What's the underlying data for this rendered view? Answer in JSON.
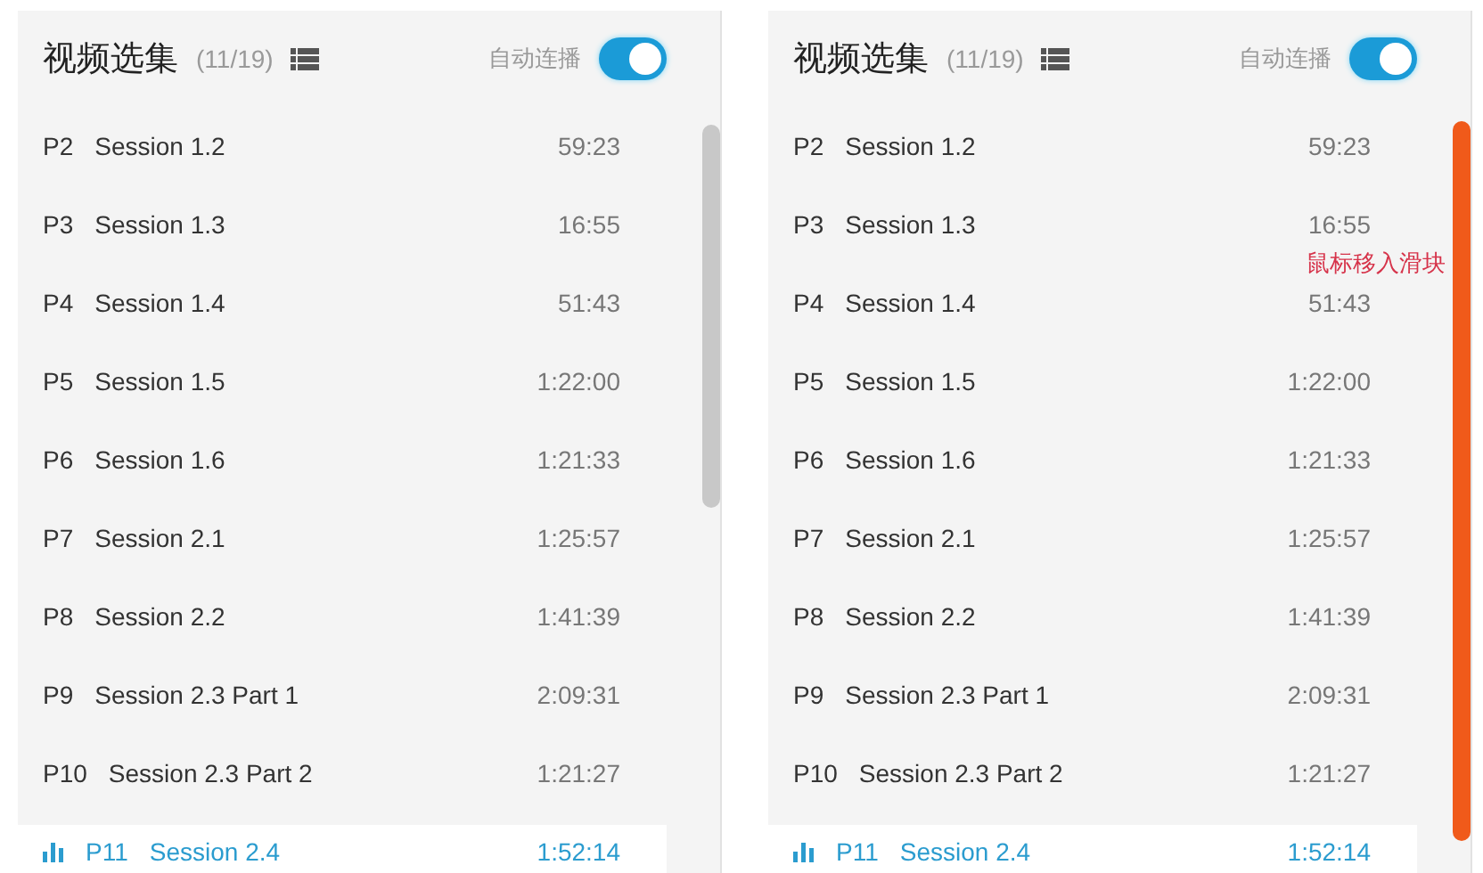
{
  "panels": [
    {
      "title": "视频选集",
      "count": "(11/19)",
      "autoplay": {
        "label": "自动连播",
        "on": true
      },
      "scrollbar": {
        "hovered": false
      },
      "items": [
        {
          "index": "P2",
          "title": "Session 1.2",
          "duration": "59:23",
          "selected": false
        },
        {
          "index": "P3",
          "title": "Session 1.3",
          "duration": "16:55",
          "selected": false
        },
        {
          "index": "P4",
          "title": "Session 1.4",
          "duration": "51:43",
          "selected": false
        },
        {
          "index": "P5",
          "title": "Session 1.5",
          "duration": "1:22:00",
          "selected": false
        },
        {
          "index": "P6",
          "title": "Session 1.6",
          "duration": "1:21:33",
          "selected": false
        },
        {
          "index": "P7",
          "title": "Session 2.1",
          "duration": "1:25:57",
          "selected": false
        },
        {
          "index": "P8",
          "title": "Session 2.2",
          "duration": "1:41:39",
          "selected": false
        },
        {
          "index": "P9",
          "title": "Session 2.3 Part 1",
          "duration": "2:09:31",
          "selected": false
        },
        {
          "index": "P10",
          "title": "Session 2.3 Part 2",
          "duration": "1:21:27",
          "selected": false
        },
        {
          "index": "P11",
          "title": "Session 2.4",
          "duration": "1:52:14",
          "selected": true
        }
      ]
    },
    {
      "title": "视频选集",
      "count": "(11/19)",
      "autoplay": {
        "label": "自动连播",
        "on": true
      },
      "scrollbar": {
        "hovered": true
      },
      "annotation": "鼠标移入滑块",
      "items": [
        {
          "index": "P2",
          "title": "Session 1.2",
          "duration": "59:23",
          "selected": false
        },
        {
          "index": "P3",
          "title": "Session 1.3",
          "duration": "16:55",
          "selected": false
        },
        {
          "index": "P4",
          "title": "Session 1.4",
          "duration": "51:43",
          "selected": false
        },
        {
          "index": "P5",
          "title": "Session 1.5",
          "duration": "1:22:00",
          "selected": false
        },
        {
          "index": "P6",
          "title": "Session 1.6",
          "duration": "1:21:33",
          "selected": false
        },
        {
          "index": "P7",
          "title": "Session 2.1",
          "duration": "1:25:57",
          "selected": false
        },
        {
          "index": "P8",
          "title": "Session 2.2",
          "duration": "1:41:39",
          "selected": false
        },
        {
          "index": "P9",
          "title": "Session 2.3 Part 1",
          "duration": "2:09:31",
          "selected": false
        },
        {
          "index": "P10",
          "title": "Session 2.3 Part 2",
          "duration": "1:21:27",
          "selected": false
        },
        {
          "index": "P11",
          "title": "Session 2.4",
          "duration": "1:52:14",
          "selected": true
        }
      ]
    }
  ]
}
